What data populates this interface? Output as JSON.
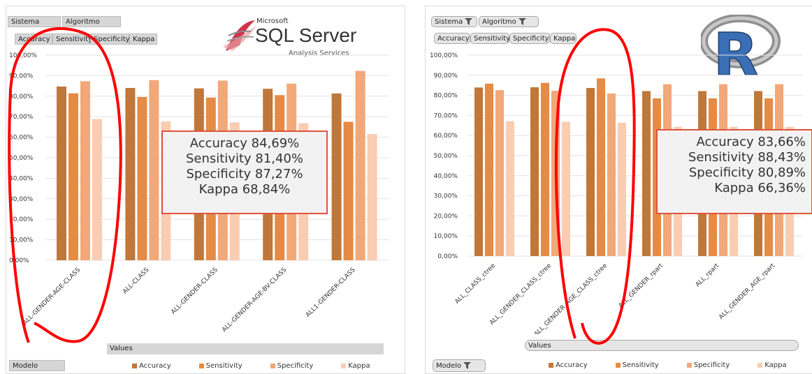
{
  "left_panel": {
    "filters": {
      "sistema": "Sistema",
      "algoritmo": "Algoritmo",
      "modelo": "Modelo"
    },
    "measure_buttons": [
      "Accuracy",
      "Sensitivity",
      "Specificity",
      "Kappa"
    ],
    "logo": {
      "brand": "Microsoft",
      "product": "SQL Server",
      "subtitle": "Analysis Services"
    },
    "values_label": "Values",
    "callout": [
      "Accuracy 84,69%",
      "Sensitivity 81,40%",
      "Specificity 87,27%",
      "Kappa 68,84%"
    ]
  },
  "right_panel": {
    "filters": {
      "sistema": "Sistema",
      "algoritmo": "Algoritmo",
      "modelo": "Modelo"
    },
    "measure_buttons": [
      "Accuracy",
      "Sensitivity",
      "Specificity",
      "Kappa"
    ],
    "logo": {
      "letter": "R"
    },
    "values_label": "Values",
    "callout": [
      "Accuracy 83,66%",
      "Sensitivity 88,43%",
      "Specificity 80,89%",
      "Kappa 66,36%"
    ]
  },
  "colors": {
    "accuracy": "#c0773a",
    "sensitivity": "#e58b45",
    "specificity": "#f2a878",
    "kappa": "#f9cdb1",
    "highlight": "#ff0000",
    "callout_border": "#e0533b"
  },
  "chart_data": [
    {
      "type": "bar",
      "ylim": [
        0,
        100
      ],
      "yticks": [
        "0,00%",
        "10,00%",
        "20,00%",
        "30,00%",
        "40,00%",
        "50,00%",
        "60,00%",
        "70,00%",
        "80,00%",
        "90,00%",
        "100,00%"
      ],
      "categories": [
        "ALL-GENDER-AGE-CLASS",
        "ALL-CLASS",
        "ALL-GENDER-CLASS",
        "ALL-GENDER-AGE-BV-CLASS",
        "ALL1-GENDER-CLASS"
      ],
      "series": [
        {
          "name": "Accuracy",
          "values": [
            84.69,
            84.0,
            83.8,
            83.6,
            81.3
          ]
        },
        {
          "name": "Sensitivity",
          "values": [
            81.4,
            79.6,
            79.3,
            80.5,
            67.5
          ]
        },
        {
          "name": "Specificity",
          "values": [
            87.27,
            87.8,
            87.6,
            86.1,
            92.3
          ]
        },
        {
          "name": "Kappa",
          "values": [
            68.84,
            67.7,
            67.2,
            66.8,
            61.5
          ]
        }
      ],
      "legend": [
        "Accuracy",
        "Sensitivity",
        "Specificity",
        "Kappa"
      ],
      "grid": true,
      "legend_position": "bottom"
    },
    {
      "type": "bar",
      "ylim": [
        0,
        100
      ],
      "yticks": [
        "0,00%",
        "10,00%",
        "20,00%",
        "30,00%",
        "40,00%",
        "50,00%",
        "60,00%",
        "70,00%",
        "80,00%",
        "90,00%",
        "100,00%"
      ],
      "categories": [
        "ALL_CLASS_ctree",
        "ALL_GENDER_CLASS_ctree",
        "ALL_GENDER_AGE_CLASS_ctree",
        "ALL_GENDER_rpart",
        "ALL_rpart",
        "ALL_GENDER_AGE_rpart"
      ],
      "series": [
        {
          "name": "Accuracy",
          "values": [
            83.9,
            84.0,
            83.66,
            82.1,
            82.1,
            82.1
          ]
        },
        {
          "name": "Sensitivity",
          "values": [
            85.8,
            86.2,
            88.43,
            78.5,
            78.5,
            78.5
          ]
        },
        {
          "name": "Specificity",
          "values": [
            82.6,
            82.3,
            80.89,
            85.5,
            85.5,
            85.5
          ]
        },
        {
          "name": "Kappa",
          "values": [
            67.1,
            66.8,
            66.36,
            64.3,
            64.3,
            64.3
          ]
        }
      ],
      "legend": [
        "Accuracy",
        "Sensitivity",
        "Specificity",
        "Kappa"
      ],
      "grid": true,
      "legend_position": "bottom"
    }
  ]
}
